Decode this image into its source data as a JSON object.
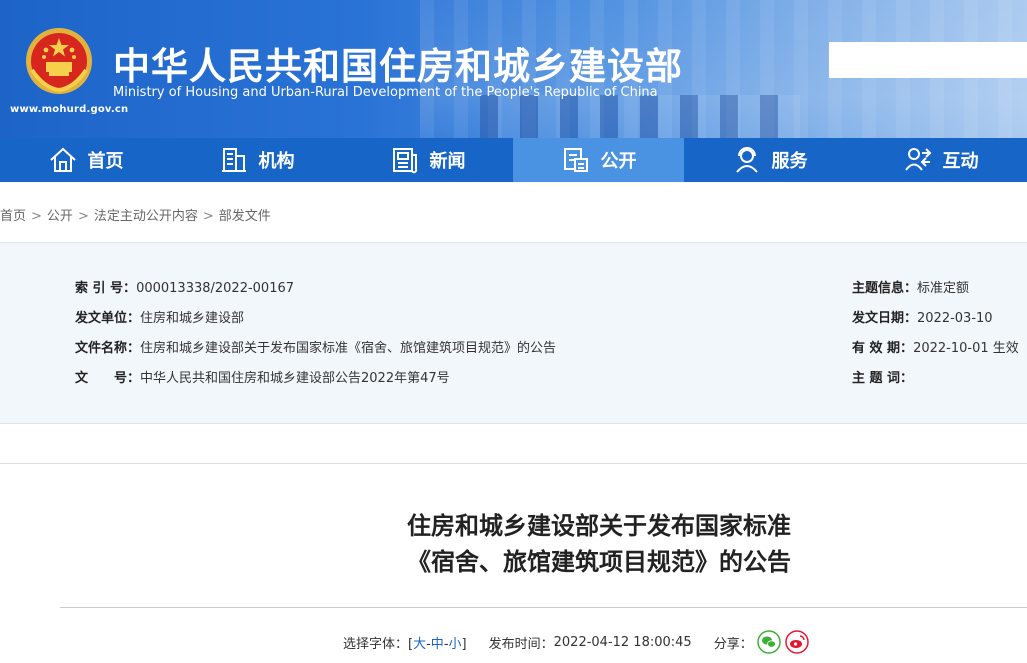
{
  "header": {
    "site_title": "中华人民共和国住房和城乡建设部",
    "site_title_en": "Ministry of Housing and Urban-Rural Development of the People's Republic of China",
    "site_url": "www.mohurd.gov.cn",
    "search_placeholder": ""
  },
  "nav": [
    {
      "label": "首页",
      "icon": "home-icon"
    },
    {
      "label": "机构",
      "icon": "building-icon"
    },
    {
      "label": "新闻",
      "icon": "newspaper-icon"
    },
    {
      "label": "公开",
      "icon": "document-icon",
      "active": true
    },
    {
      "label": "服务",
      "icon": "person-service-icon"
    },
    {
      "label": "互动",
      "icon": "interaction-icon"
    }
  ],
  "breadcrumb": [
    "首页",
    "公开",
    "法定主动公开内容",
    "部发文件"
  ],
  "info": {
    "index_label": "索 引 号：",
    "index_value": "000013338/2022-00167",
    "unit_label": "发文单位：",
    "unit_value": "住房和城乡建设部",
    "name_label": "文件名称：",
    "name_value": "住房和城乡建设部关于发布国家标准《宿舍、旅馆建筑项目规范》的公告",
    "doc_no_label": "文　　号：",
    "doc_no_value": "中华人民共和国住房和城乡建设部公告2022年第47号",
    "topic_label": "主题信息：",
    "topic_value": "标准定额",
    "date_label": "发文日期：",
    "date_value": "2022-03-10",
    "validity_label": "有 效 期：",
    "validity_value": "2022-10-01 生效",
    "keywords_label": "主 题 词：",
    "keywords_value": ""
  },
  "article": {
    "title_line1": "住房和城乡建设部关于发布国家标准",
    "title_line2": "《宿舍、旅馆建筑项目规范》的公告"
  },
  "meta": {
    "font_label": "选择字体：[",
    "font_large": "大",
    "font_medium": "中",
    "font_small": "小",
    "font_sep": "-",
    "font_close": "]",
    "publish_label": "发布时间：",
    "publish_time": "2022-04-12 18:00:45",
    "share_label": "分享："
  },
  "colors": {
    "nav_bg": "#1765c6",
    "nav_active": "#4a92e2",
    "info_bg": "#f2f7fc",
    "wechat": "#3cb034",
    "weibo": "#e6162d"
  }
}
